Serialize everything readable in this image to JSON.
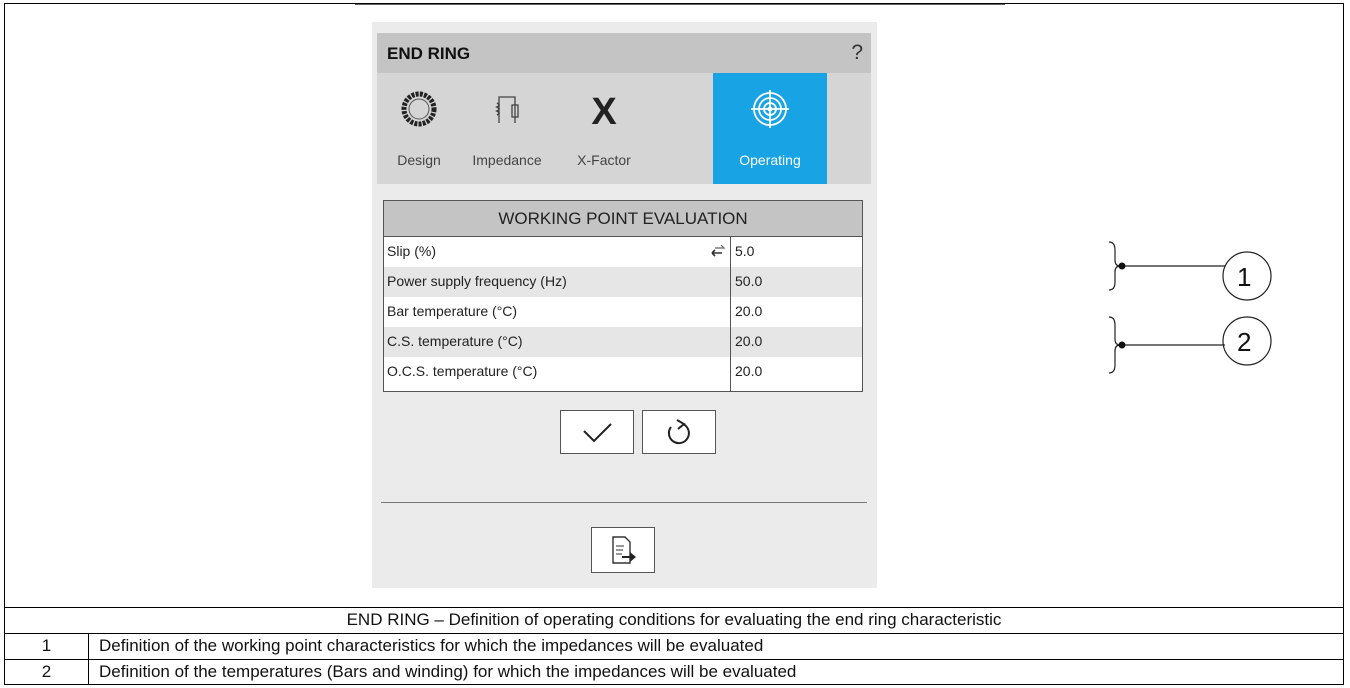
{
  "dialog": {
    "title": "END RING",
    "help": "?",
    "tabs": [
      {
        "label": "Design",
        "icon": "ring-icon"
      },
      {
        "label": "Impedance",
        "icon": "circuit-icon"
      },
      {
        "label": "X-Factor",
        "icon": "x-icon"
      },
      {
        "label": "Operating",
        "icon": "target-icon",
        "active": true
      }
    ],
    "section_title": "WORKING POINT EVALUATION",
    "rows": [
      {
        "label": "Slip (%)",
        "value": "5.0"
      },
      {
        "label": "Power supply frequency (Hz)",
        "value": "50.0"
      },
      {
        "label": "Bar temperature (°C)",
        "value": "20.0"
      },
      {
        "label": "C.S. temperature (°C)",
        "value": "20.0"
      },
      {
        "label": "O.C.S. temperature (°C)",
        "value": "20.0"
      }
    ]
  },
  "callouts": [
    "1",
    "2"
  ],
  "caption": {
    "title": "END RING – Definition of operating conditions for evaluating the end ring characteristic",
    "items": [
      {
        "num": "1",
        "text": "Definition of the working point characteristics for which the impedances will be evaluated"
      },
      {
        "num": "2",
        "text": "Definition of the temperatures (Bars and winding) for which the impedances will be evaluated"
      }
    ]
  },
  "colors": {
    "active_tab": "#18a3e4",
    "panel_bg": "#ebebeb",
    "header_bg": "#c4c4c4"
  }
}
